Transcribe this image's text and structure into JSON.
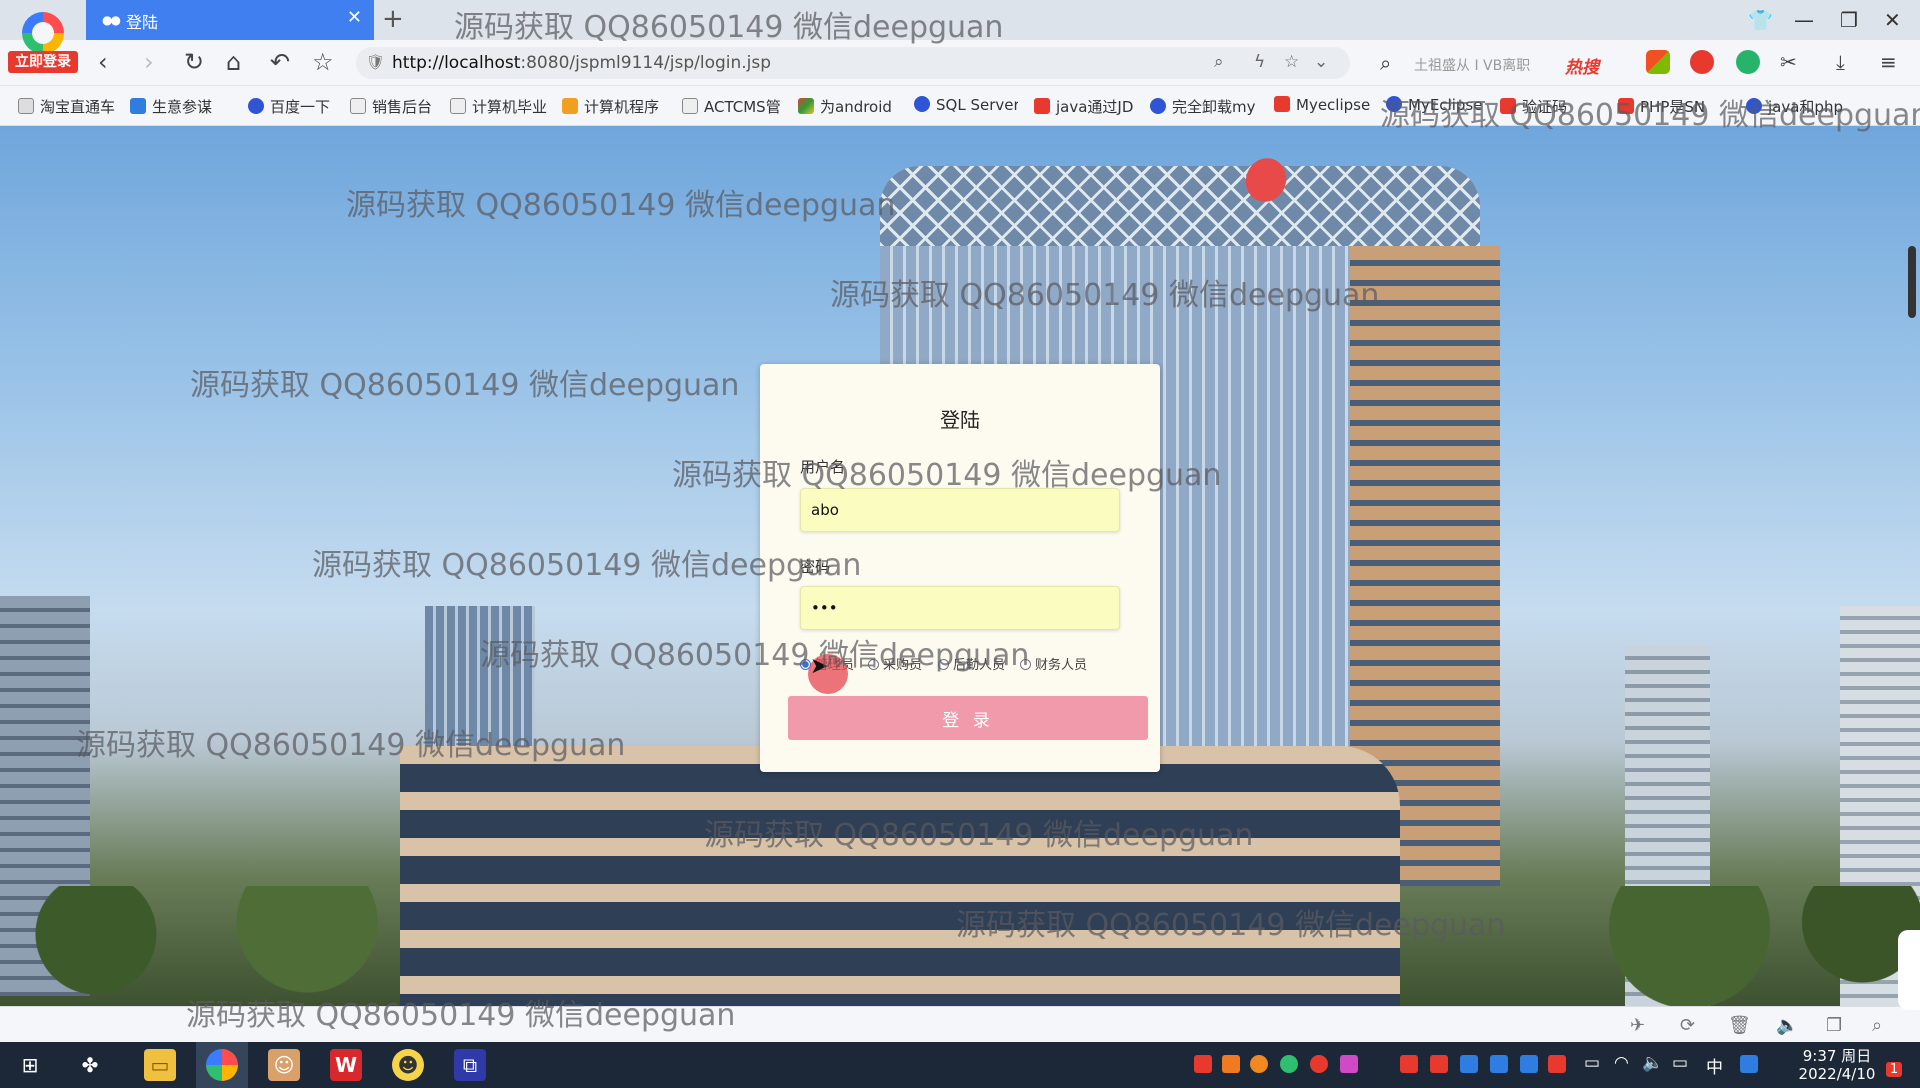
{
  "browser": {
    "login_badge": "立即登录",
    "tab": {
      "title": "登陆"
    },
    "url": {
      "host": "http://localhost",
      "rest": ":8080/jspml9114/jsp/login.jsp"
    },
    "search_placeholder": "土祖盛从 I VB离职",
    "hot_label": "热搜"
  },
  "bookmarks": [
    {
      "label": "淘宝直通车",
      "color": "#888888"
    },
    {
      "label": "生意参谋",
      "color": "#2f7de1"
    },
    {
      "label": "百度一下",
      "color": "#2f55d4"
    },
    {
      "label": "销售后台",
      "color": "#888888"
    },
    {
      "label": "计算机毕业",
      "color": "#888888"
    },
    {
      "label": "计算机程序",
      "color": "#f0a020"
    },
    {
      "label": "ACTCMS管",
      "color": "#888888"
    },
    {
      "label": "为android",
      "color": "#d8452c"
    },
    {
      "label": "SQL Server",
      "color": "#2f55d4"
    },
    {
      "label": "java通过JD",
      "color": "#e8392f"
    },
    {
      "label": "完全卸载my",
      "color": "#2f55d4"
    },
    {
      "label": "Myeclipse",
      "color": "#e8392f"
    },
    {
      "label": "MyEclipse",
      "color": "#2f55d4"
    },
    {
      "label": "验证码",
      "color": "#e8392f"
    },
    {
      "label": "PHP是SN",
      "color": "#e8392f"
    },
    {
      "label": "java和php",
      "color": "#2f55d4"
    }
  ],
  "watermark": "源码获取 QQ86050149 微信deepguan",
  "login": {
    "title": "登陆",
    "username_label": "用户名",
    "username_value": "abo",
    "password_label": "密码",
    "password_value": "•••",
    "roles": [
      {
        "label": "管理员",
        "selected": true
      },
      {
        "label": "采购员",
        "selected": false
      },
      {
        "label": "后勤人员",
        "selected": false
      },
      {
        "label": "财务人员",
        "selected": false
      }
    ],
    "submit_label": "登 录"
  },
  "taskbar": {
    "ime": "中",
    "clock_time": "9:37 周日",
    "clock_date": "2022/4/10",
    "notif_count": "1"
  },
  "colors": {
    "tab_active": "#3f7ff0",
    "login_button": "#f09aac",
    "input_bg": "#fbfcc0",
    "radio_selected": "#3a6fd8"
  }
}
